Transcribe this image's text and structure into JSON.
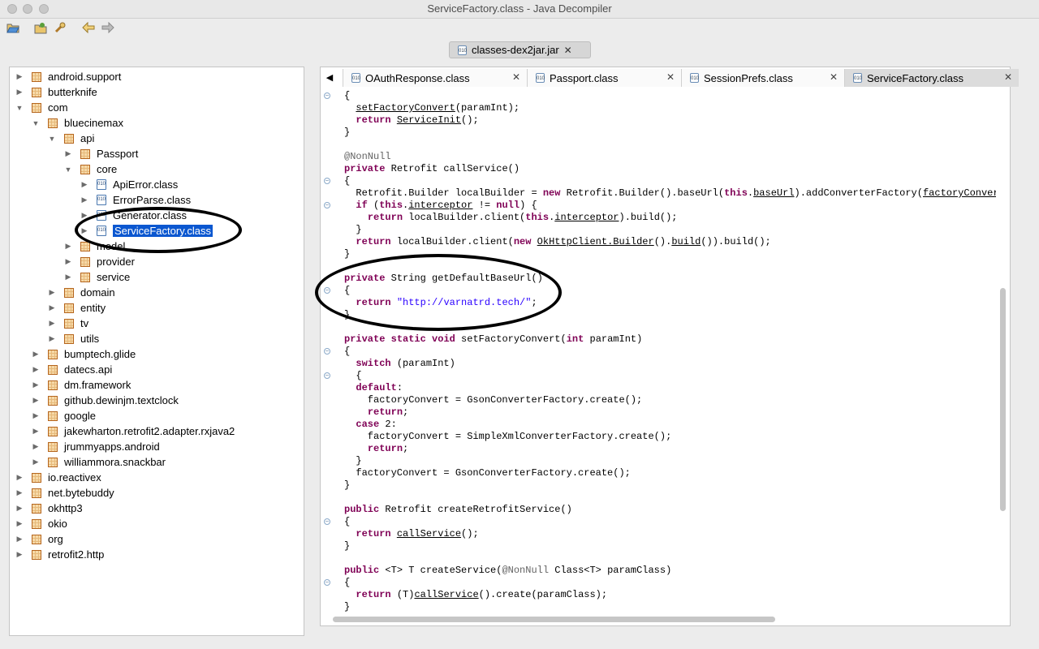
{
  "window": {
    "title": "ServiceFactory.class - Java Decompiler"
  },
  "toolbar": {
    "open_icon": "folder-open-icon",
    "open_type_icon": "open-type-icon",
    "search_icon": "search-icon",
    "back_icon": "back-arrow-icon",
    "forward_icon": "forward-arrow-icon"
  },
  "archive_tab": {
    "label": "classes-dex2jar.jar"
  },
  "tree": [
    {
      "label": "android.support",
      "kind": "pkg",
      "depth": 0,
      "arrow": "▶"
    },
    {
      "label": "butterknife",
      "kind": "pkg",
      "depth": 0,
      "arrow": "▶"
    },
    {
      "label": "com",
      "kind": "pkg",
      "depth": 0,
      "arrow": "▼"
    },
    {
      "label": "bluecinemax",
      "kind": "pkg",
      "depth": 1,
      "arrow": "▼"
    },
    {
      "label": "api",
      "kind": "pkg",
      "depth": 2,
      "arrow": "▼"
    },
    {
      "label": "Passport",
      "kind": "pkg",
      "depth": 3,
      "arrow": "▶"
    },
    {
      "label": "core",
      "kind": "pkg",
      "depth": 3,
      "arrow": "▼"
    },
    {
      "label": "ApiError.class",
      "kind": "cls",
      "depth": 4,
      "arrow": "▶"
    },
    {
      "label": "ErrorParse.class",
      "kind": "cls",
      "depth": 4,
      "arrow": "▶"
    },
    {
      "label": "Generator.class",
      "kind": "cls",
      "depth": 4,
      "arrow": "▶"
    },
    {
      "label": "ServiceFactory.class",
      "kind": "cls",
      "depth": 4,
      "arrow": "▶",
      "selected": true
    },
    {
      "label": "model",
      "kind": "pkg",
      "depth": 3,
      "arrow": "▶"
    },
    {
      "label": "provider",
      "kind": "pkg",
      "depth": 3,
      "arrow": "▶"
    },
    {
      "label": "service",
      "kind": "pkg",
      "depth": 3,
      "arrow": "▶"
    },
    {
      "label": "domain",
      "kind": "pkg",
      "depth": 2,
      "arrow": "▶"
    },
    {
      "label": "entity",
      "kind": "pkg",
      "depth": 2,
      "arrow": "▶"
    },
    {
      "label": "tv",
      "kind": "pkg",
      "depth": 2,
      "arrow": "▶"
    },
    {
      "label": "utils",
      "kind": "pkg",
      "depth": 2,
      "arrow": "▶"
    },
    {
      "label": "bumptech.glide",
      "kind": "pkg",
      "depth": 1,
      "arrow": "▶"
    },
    {
      "label": "datecs.api",
      "kind": "pkg",
      "depth": 1,
      "arrow": "▶"
    },
    {
      "label": "dm.framework",
      "kind": "pkg",
      "depth": 1,
      "arrow": "▶"
    },
    {
      "label": "github.dewinjm.textclock",
      "kind": "pkg",
      "depth": 1,
      "arrow": "▶"
    },
    {
      "label": "google",
      "kind": "pkg",
      "depth": 1,
      "arrow": "▶"
    },
    {
      "label": "jakewharton.retrofit2.adapter.rxjava2",
      "kind": "pkg",
      "depth": 1,
      "arrow": "▶"
    },
    {
      "label": "jrummyapps.android",
      "kind": "pkg",
      "depth": 1,
      "arrow": "▶"
    },
    {
      "label": "williammora.snackbar",
      "kind": "pkg",
      "depth": 1,
      "arrow": "▶"
    },
    {
      "label": "io.reactivex",
      "kind": "pkg",
      "depth": 0,
      "arrow": "▶"
    },
    {
      "label": "net.bytebuddy",
      "kind": "pkg",
      "depth": 0,
      "arrow": "▶"
    },
    {
      "label": "okhttp3",
      "kind": "pkg",
      "depth": 0,
      "arrow": "▶"
    },
    {
      "label": "okio",
      "kind": "pkg",
      "depth": 0,
      "arrow": "▶"
    },
    {
      "label": "org",
      "kind": "pkg",
      "depth": 0,
      "arrow": "▶"
    },
    {
      "label": "retrofit2.http",
      "kind": "pkg",
      "depth": 0,
      "arrow": "▶"
    }
  ],
  "editor_tabs": [
    {
      "label": "OAuthResponse.class",
      "active": false
    },
    {
      "label": "Passport.class",
      "active": false
    },
    {
      "label": "SessionPrefs.class",
      "active": false
    },
    {
      "label": "ServiceFactory.class",
      "active": true
    }
  ],
  "code_lines": [
    [
      [
        "{",
        ""
      ]
    ],
    [
      [
        "  ",
        ""
      ],
      [
        "setFactoryConvert",
        "ul"
      ],
      [
        "(paramInt);",
        ""
      ]
    ],
    [
      [
        "  ",
        ""
      ],
      [
        "return",
        "kw"
      ],
      [
        " ",
        ""
      ],
      [
        "ServiceInit",
        "ul"
      ],
      [
        "();",
        ""
      ]
    ],
    [
      [
        "}",
        ""
      ]
    ],
    [
      [
        "",
        ""
      ]
    ],
    [
      [
        "@NonNull",
        "ann"
      ]
    ],
    [
      [
        "private",
        "kw"
      ],
      [
        " Retrofit callService()",
        ""
      ]
    ],
    [
      [
        "{",
        ""
      ]
    ],
    [
      [
        "  Retrofit.Builder localBuilder = ",
        ""
      ],
      [
        "new",
        "kw"
      ],
      [
        " Retrofit.Builder().baseUrl(",
        ""
      ],
      [
        "this",
        "kw"
      ],
      [
        ".",
        ""
      ],
      [
        "baseUrl",
        "ul"
      ],
      [
        ").addConverterFactory(",
        ""
      ],
      [
        "factoryConvert",
        "ul"
      ],
      [
        ").",
        ""
      ]
    ],
    [
      [
        "  ",
        ""
      ],
      [
        "if",
        "kw"
      ],
      [
        " (",
        ""
      ],
      [
        "this",
        "kw"
      ],
      [
        ".",
        ""
      ],
      [
        "interceptor",
        "ul"
      ],
      [
        " != ",
        ""
      ],
      [
        "null",
        "kw"
      ],
      [
        ") {",
        ""
      ]
    ],
    [
      [
        "    ",
        ""
      ],
      [
        "return",
        "kw"
      ],
      [
        " localBuilder.client(",
        ""
      ],
      [
        "this",
        "kw"
      ],
      [
        ".",
        ""
      ],
      [
        "interceptor",
        "ul"
      ],
      [
        ").build();",
        ""
      ]
    ],
    [
      [
        "  }",
        ""
      ]
    ],
    [
      [
        "  ",
        ""
      ],
      [
        "return",
        "kw"
      ],
      [
        " localBuilder.client(",
        ""
      ],
      [
        "new",
        "kw"
      ],
      [
        " ",
        ""
      ],
      [
        "OkHttpClient.Builder",
        "ul"
      ],
      [
        "().",
        ""
      ],
      [
        "build",
        "ul"
      ],
      [
        "()).build();",
        ""
      ]
    ],
    [
      [
        "}",
        ""
      ]
    ],
    [
      [
        "",
        ""
      ]
    ],
    [
      [
        "private",
        "kw"
      ],
      [
        " String getDefaultBaseUrl()",
        ""
      ]
    ],
    [
      [
        "{",
        ""
      ]
    ],
    [
      [
        "  ",
        ""
      ],
      [
        "return",
        "kw"
      ],
      [
        " ",
        ""
      ],
      [
        "\"http://varnatrd.tech/\"",
        "str"
      ],
      [
        ";",
        ""
      ]
    ],
    [
      [
        "}",
        ""
      ]
    ],
    [
      [
        "",
        ""
      ]
    ],
    [
      [
        "private",
        "kw"
      ],
      [
        " ",
        ""
      ],
      [
        "static",
        "kw"
      ],
      [
        " ",
        ""
      ],
      [
        "void",
        "kw"
      ],
      [
        " setFactoryConvert(",
        ""
      ],
      [
        "int",
        "kw"
      ],
      [
        " paramInt)",
        ""
      ]
    ],
    [
      [
        "{",
        ""
      ]
    ],
    [
      [
        "  ",
        ""
      ],
      [
        "switch",
        "kw"
      ],
      [
        " (paramInt)",
        ""
      ]
    ],
    [
      [
        "  {",
        ""
      ]
    ],
    [
      [
        "  ",
        ""
      ],
      [
        "default",
        "kw"
      ],
      [
        ":",
        ""
      ]
    ],
    [
      [
        "    factoryConvert = GsonConverterFactory.create();",
        ""
      ]
    ],
    [
      [
        "    ",
        ""
      ],
      [
        "return",
        "kw"
      ],
      [
        ";",
        ""
      ]
    ],
    [
      [
        "  ",
        ""
      ],
      [
        "case",
        "kw"
      ],
      [
        " 2:",
        ""
      ]
    ],
    [
      [
        "    factoryConvert = SimpleXmlConverterFactory.create();",
        ""
      ]
    ],
    [
      [
        "    ",
        ""
      ],
      [
        "return",
        "kw"
      ],
      [
        ";",
        ""
      ]
    ],
    [
      [
        "  }",
        ""
      ]
    ],
    [
      [
        "  factoryConvert = GsonConverterFactory.create();",
        ""
      ]
    ],
    [
      [
        "}",
        ""
      ]
    ],
    [
      [
        "",
        ""
      ]
    ],
    [
      [
        "public",
        "kw"
      ],
      [
        " Retrofit createRetrofitService()",
        ""
      ]
    ],
    [
      [
        "{",
        ""
      ]
    ],
    [
      [
        "  ",
        ""
      ],
      [
        "return",
        "kw"
      ],
      [
        " ",
        ""
      ],
      [
        "callService",
        "ul"
      ],
      [
        "();",
        ""
      ]
    ],
    [
      [
        "}",
        ""
      ]
    ],
    [
      [
        "",
        ""
      ]
    ],
    [
      [
        "public",
        "kw"
      ],
      [
        " <T> T createService(",
        ""
      ],
      [
        "@NonNull",
        "ann"
      ],
      [
        " Class<T> paramClass)",
        ""
      ]
    ],
    [
      [
        "{",
        ""
      ]
    ],
    [
      [
        "  ",
        ""
      ],
      [
        "return",
        "kw"
      ],
      [
        " (T)",
        ""
      ],
      [
        "callService",
        "ul"
      ],
      [
        "().create(paramClass);",
        ""
      ]
    ],
    [
      [
        "}",
        ""
      ]
    ]
  ],
  "fold_markers": [
    0,
    7,
    9,
    16,
    21,
    23,
    35,
    40
  ],
  "colors": {
    "selection": "#0b57d0",
    "keyword": "#7f0055",
    "string": "#2a00ff",
    "annotation": "#646464"
  }
}
